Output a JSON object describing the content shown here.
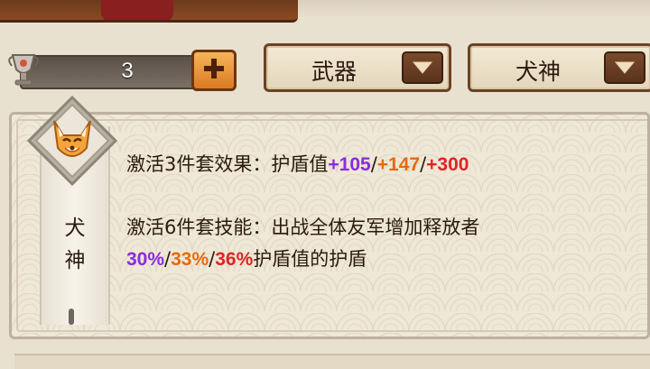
{
  "banner": {
    "title": ""
  },
  "currency": {
    "value": "3",
    "icon": "trophy-cup-icon",
    "plus_icon": "plus-icon"
  },
  "filters": {
    "weapon": {
      "selected": "武器",
      "icon": "chevron-down-icon"
    },
    "set": {
      "selected": "犬神",
      "icon": "chevron-down-icon"
    }
  },
  "set_panel": {
    "name": "犬神",
    "emblem_icon": "fox-mask-icon",
    "set3": {
      "prefix": "激活3件套效果：护盾值",
      "values": [
        "+105",
        "+147",
        "+300"
      ],
      "separator": "/"
    },
    "set6": {
      "line1": "激活6件套技能：出战全体友军增加释放者",
      "values": [
        "30%",
        "33%",
        "36%"
      ],
      "separator": "/",
      "suffix": "护盾值的护盾"
    }
  },
  "colors": {
    "tier_purple": "#8a2be2",
    "tier_orange": "#e46a10",
    "tier_red": "#e02424",
    "frame_brown": "#6b4226"
  }
}
